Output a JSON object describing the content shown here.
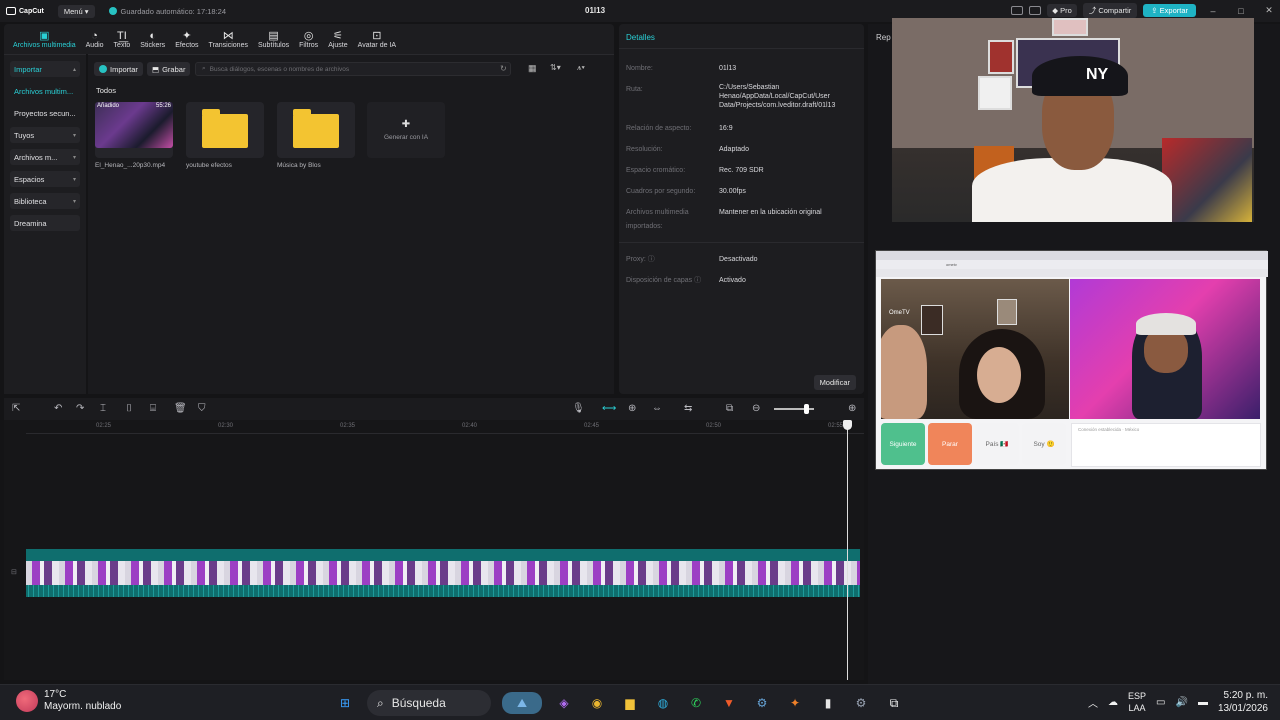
{
  "app": {
    "logo_text": "CapCut",
    "menu_label": "Menú",
    "autosave_text": "Guardado automático: 17:18:24",
    "project_title": "01l13",
    "pro_label": "Pro",
    "share_label": "Compartir",
    "export_label": "Exportar",
    "window_controls": [
      "–",
      "□",
      "✕"
    ]
  },
  "media_tabs": [
    {
      "label": "Archivos multimedia",
      "icon": "media-icon",
      "active": true
    },
    {
      "label": "Audio",
      "icon": "audio-icon"
    },
    {
      "label": "Texto",
      "icon": "text-icon"
    },
    {
      "label": "Stickers",
      "icon": "sticker-icon"
    },
    {
      "label": "Efectos",
      "icon": "effects-icon"
    },
    {
      "label": "Transiciones",
      "icon": "transition-icon"
    },
    {
      "label": "Subtítulos",
      "icon": "subtitle-icon"
    },
    {
      "label": "Filtros",
      "icon": "filter-icon"
    },
    {
      "label": "Ajuste",
      "icon": "adjust-icon"
    },
    {
      "label": "Avatar de IA",
      "icon": "avatar-icon"
    }
  ],
  "left_nav": [
    {
      "label": "Importar",
      "style": "box-teal",
      "chev": "▴"
    },
    {
      "label": "Archivos multim...",
      "style": "plain-teal",
      "chev": ""
    },
    {
      "label": "Proyectos secun...",
      "style": "plain",
      "chev": ""
    },
    {
      "label": "Tuyos",
      "style": "box",
      "chev": "▾"
    },
    {
      "label": "Archivos m...",
      "style": "box",
      "chev": "▾"
    },
    {
      "label": "Espacios",
      "style": "box",
      "chev": "▾"
    },
    {
      "label": "Biblioteca",
      "style": "box",
      "chev": "▾"
    },
    {
      "label": "Dreamina",
      "style": "box",
      "chev": ""
    }
  ],
  "media": {
    "import_label": "Importar",
    "record_label": "Grabar",
    "search_placeholder": "Busca diálogos, escenas o nombres de archivos",
    "filter_all": "Todos",
    "items": [
      {
        "caption": "El_Henao_...20p30.mp4",
        "added": "Añadido",
        "duration": "55:26"
      },
      {
        "caption": "youtube efectos"
      },
      {
        "caption": "Música by Blos"
      }
    ],
    "generate_label": "Generar con IA"
  },
  "details": {
    "title": "Detalles",
    "rows": [
      {
        "k": "Nombre:",
        "v": "01l13"
      },
      {
        "k": "Ruta:",
        "v": "C:/Users/Sebastian Henao/AppData/Local/CapCut/User Data/Projects/com.lveditor.draft/01l13"
      },
      {
        "k": "Relación de aspecto:",
        "v": "16:9"
      },
      {
        "k": "Resolución:",
        "v": "Adaptado"
      },
      {
        "k": "Espacio cromático:",
        "v": "Rec. 709 SDR"
      },
      {
        "k": "Cuadros por segundo:",
        "v": "30.00fps"
      },
      {
        "k": "Archivos multimedia importados:",
        "v": "Mantener en la ubicación original"
      },
      {
        "k": "Proxy: ⓘ",
        "v": "Desactivado"
      },
      {
        "k": "Disposición de capas ⓘ",
        "v": "Activado"
      }
    ],
    "modify_label": "Modificar"
  },
  "right_panel": {
    "title": "Rep"
  },
  "browser": {
    "url": "ometv",
    "logo": "OmeTV",
    "buttons": [
      {
        "label": "Siguiente",
        "color": "#4fc08d"
      },
      {
        "label": "Parar",
        "color": "#f0855a"
      },
      {
        "label": "País 🇲🇽",
        "color": "#f3f3f5"
      },
      {
        "label": "Soy 🙂",
        "color": "#f3f3f5"
      }
    ],
    "chat_text": "Conexión establecida · México"
  },
  "timeline": {
    "ticks": [
      "02:25",
      "02:30",
      "02:35",
      "02:40",
      "02:45",
      "02:50",
      "02:55"
    ],
    "tools_left": [
      "⇱",
      "↶",
      "↷",
      "⌶",
      "⌷",
      "⌸",
      "🗑",
      "⛉"
    ],
    "tools_right": [
      "🎙",
      "⟷",
      "⊕",
      "⇔",
      "⇆",
      "⧉",
      "⊖",
      "⊕"
    ]
  },
  "taskbar": {
    "temp": "17°C",
    "weather_text": "Mayorm. nublado",
    "search_label": "Búsqueda",
    "lang_top": "ESP",
    "lang_bottom": "LAA",
    "time": "5:20 p. m.",
    "date": "13/01/2026",
    "apps": [
      {
        "name": "start-icon",
        "glyph": "⊞",
        "color": "#3aa0ff"
      },
      {
        "name": "landscape-app-icon",
        "glyph": "⛰",
        "color": "#7cb7e8"
      },
      {
        "name": "copilot-icon",
        "glyph": "◈",
        "color": "#b06cf0"
      },
      {
        "name": "chrome-icon",
        "glyph": "◉",
        "color": "#e9b530"
      },
      {
        "name": "file-explorer-icon",
        "glyph": "▆",
        "color": "#f2c23a"
      },
      {
        "name": "edge-icon",
        "glyph": "◍",
        "color": "#2fb0e0"
      },
      {
        "name": "whatsapp-icon",
        "glyph": "✆",
        "color": "#2fd15b"
      },
      {
        "name": "brave-icon",
        "glyph": "▼",
        "color": "#f05b2a"
      },
      {
        "name": "steam-icon",
        "glyph": "⚙",
        "color": "#66a3d6"
      },
      {
        "name": "app-icon-orange",
        "glyph": "✦",
        "color": "#f0812a"
      },
      {
        "name": "stats-app-icon",
        "glyph": "▮",
        "color": "#e6e6e6"
      },
      {
        "name": "settings-icon",
        "glyph": "⚙",
        "color": "#9aa4b4"
      },
      {
        "name": "capcut-icon",
        "glyph": "⧉",
        "color": "#ffffff"
      }
    ]
  }
}
